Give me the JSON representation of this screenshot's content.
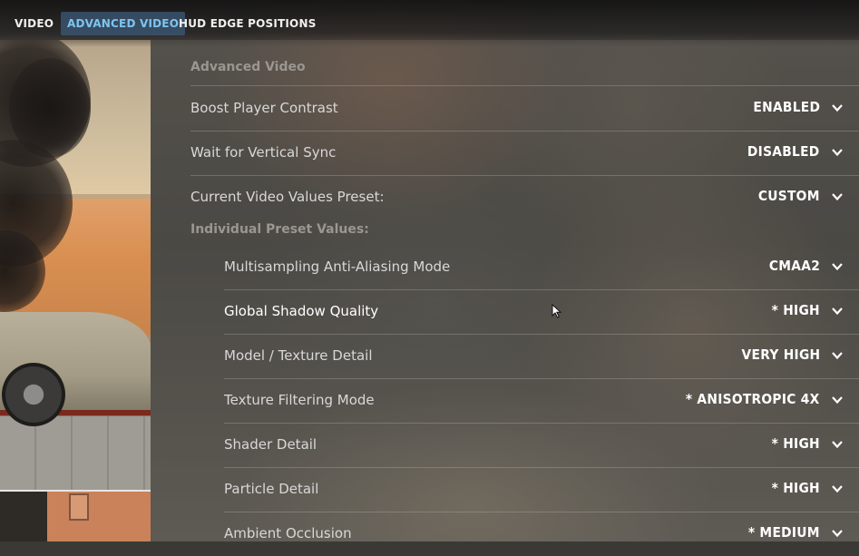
{
  "tabs": [
    {
      "label": "VIDEO",
      "active": false
    },
    {
      "label": "ADVANCED VIDEO",
      "active": true
    },
    {
      "label": "HUD EDGE POSITIONS",
      "active": false
    }
  ],
  "panel": {
    "section_title": "Advanced Video",
    "subsection_title": "Individual Preset Values:",
    "settings": [
      {
        "label": "Boost Player Contrast",
        "value": "ENABLED"
      },
      {
        "label": "Wait for Vertical Sync",
        "value": "DISABLED"
      },
      {
        "label": "Current Video Values Preset:",
        "value": "CUSTOM"
      }
    ],
    "preset_settings": [
      {
        "label": "Multisampling Anti-Aliasing Mode",
        "value": "CMAA2"
      },
      {
        "label": "Global Shadow Quality",
        "value": "* HIGH"
      },
      {
        "label": "Model / Texture Detail",
        "value": "VERY HIGH"
      },
      {
        "label": "Texture Filtering Mode",
        "value": "* ANISOTROPIC 4X"
      },
      {
        "label": "Shader Detail",
        "value": "* HIGH"
      },
      {
        "label": "Particle Detail",
        "value": "* HIGH"
      },
      {
        "label": "Ambient Occlusion",
        "value": "* MEDIUM"
      }
    ]
  },
  "colors": {
    "active_tab_text": "#7fc4ef",
    "active_tab_bg": "#3c5a78",
    "label_text": "#d8d8d8",
    "value_text": "#ffffff",
    "section_title": "#9a9690"
  },
  "icons": {
    "dropdown": "chevron-down-icon",
    "pointer": "mouse-cursor-icon"
  }
}
